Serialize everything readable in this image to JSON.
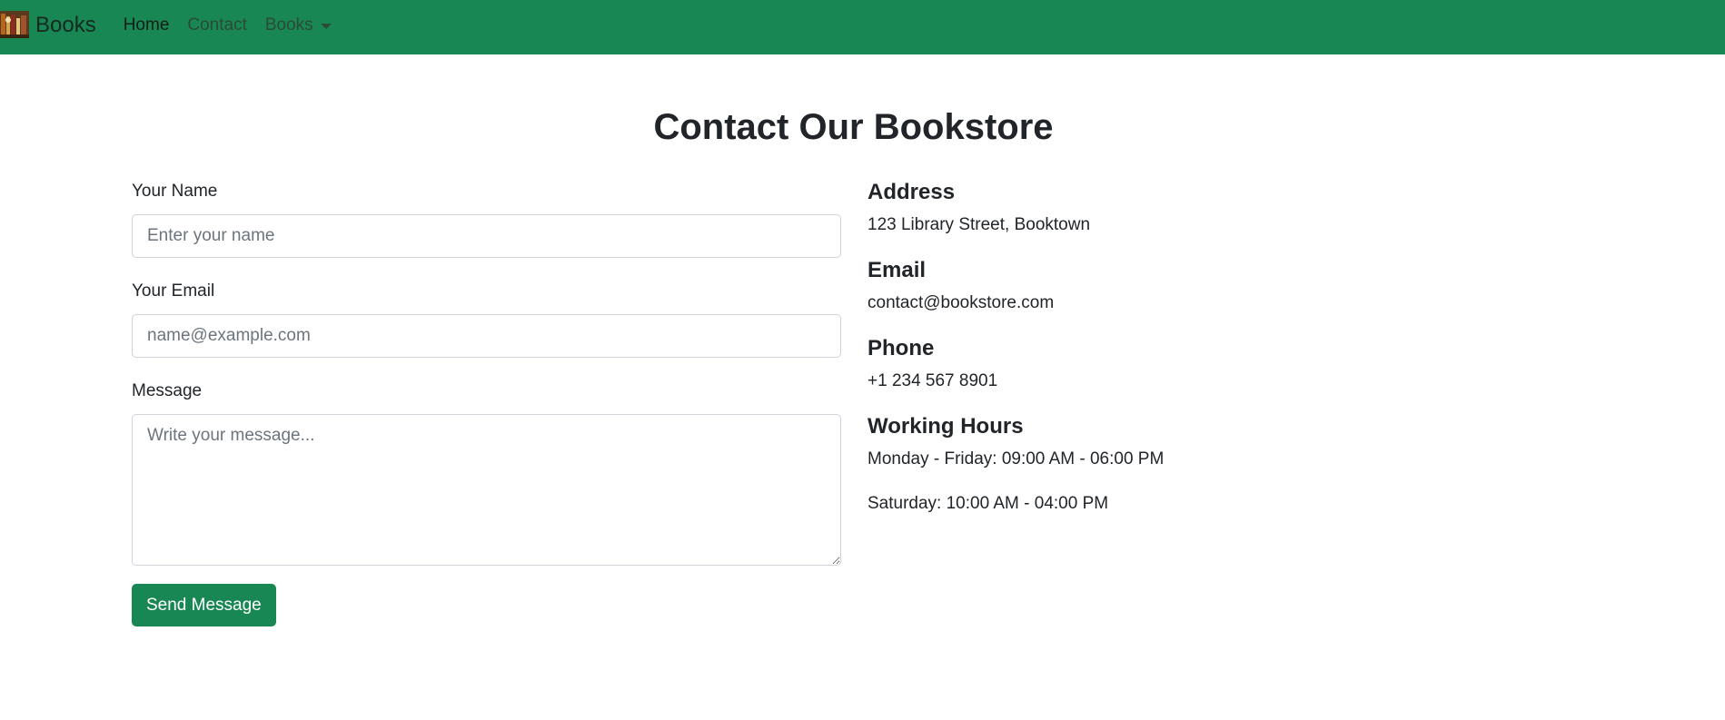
{
  "navbar": {
    "brand": "Books",
    "links": [
      {
        "label": "Home"
      },
      {
        "label": "Contact"
      },
      {
        "label": "Books"
      }
    ]
  },
  "page": {
    "title": "Contact Our Bookstore"
  },
  "form": {
    "name": {
      "label": "Your Name",
      "placeholder": "Enter your name",
      "value": ""
    },
    "email": {
      "label": "Your Email",
      "placeholder": "name@example.com",
      "value": ""
    },
    "message": {
      "label": "Message",
      "placeholder": "Write your message...",
      "value": ""
    },
    "submit_label": "Send Message"
  },
  "info": {
    "address": {
      "heading": "Address",
      "text": "123 Library Street, Booktown"
    },
    "email": {
      "heading": "Email",
      "text": "contact@bookstore.com"
    },
    "phone": {
      "heading": "Phone",
      "text": "+1 234 567 8901"
    },
    "hours": {
      "heading": "Working Hours",
      "lines": [
        "Monday - Friday: 09:00 AM - 06:00 PM",
        "Saturday: 10:00 AM - 04:00 PM"
      ]
    }
  },
  "colors": {
    "navbar_bg": "#198754",
    "button_bg": "#198754",
    "text": "#212529",
    "placeholder": "#6c757d"
  },
  "icons": {
    "brand_logo": "books-logo-icon",
    "dropdown": "caret-down-icon"
  }
}
